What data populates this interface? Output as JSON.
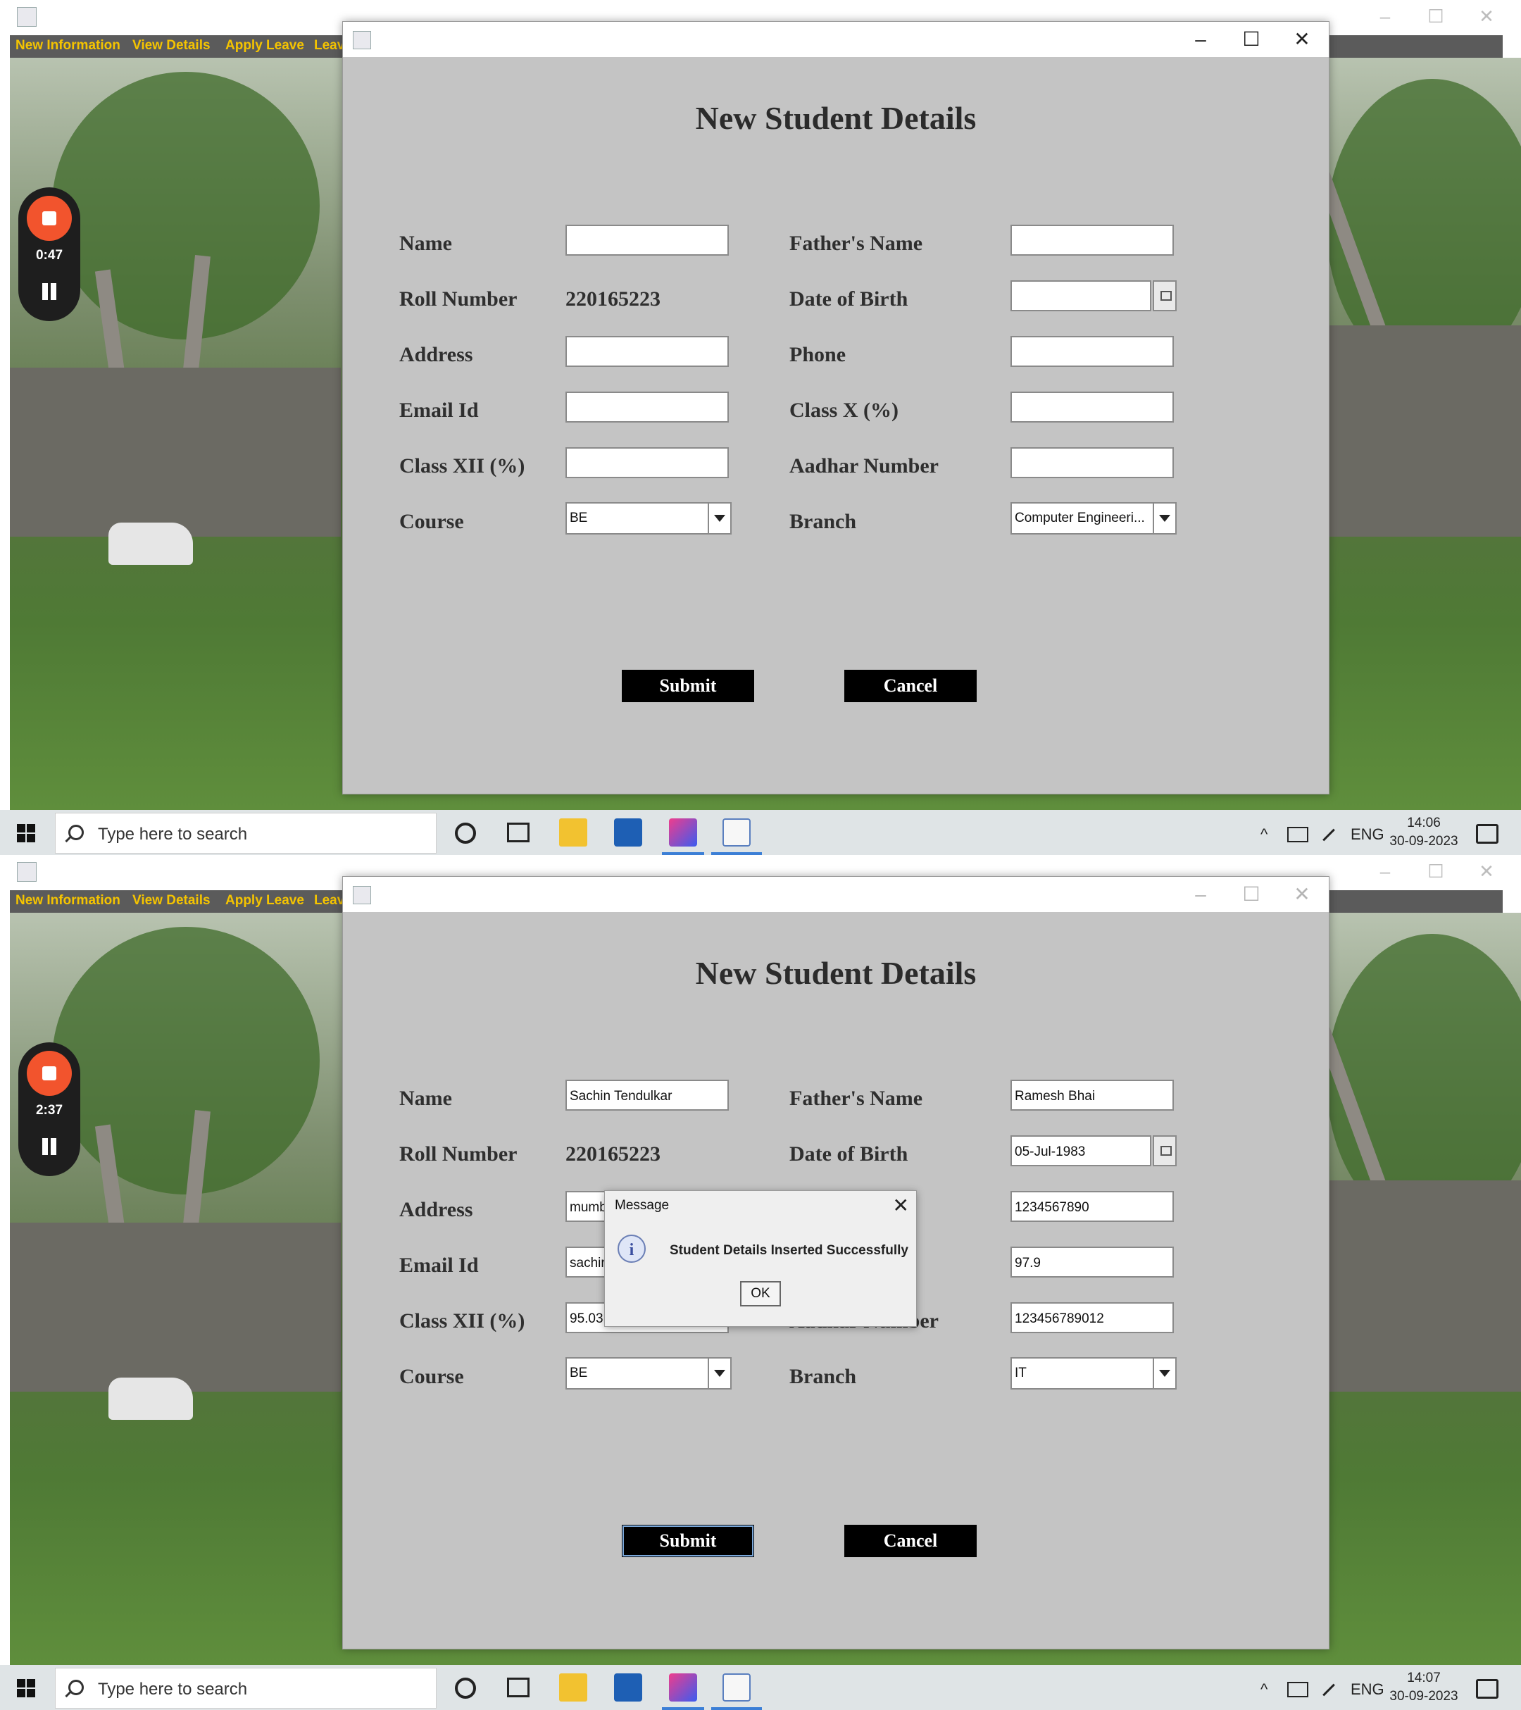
{
  "bg_window": {
    "menu": [
      "New Information",
      "View Details",
      "Apply Leave",
      "Leav"
    ],
    "controls": [
      "–",
      "☐",
      "✕"
    ]
  },
  "dialog": {
    "title": "New Student Details",
    "controls": [
      "–",
      "☐",
      "✕"
    ]
  },
  "labels": {
    "name": "Name",
    "fathers_name": "Father's Name",
    "roll_number": "Roll Number",
    "dob": "Date of Birth",
    "address": "Address",
    "phone": "Phone",
    "email": "Email Id",
    "class_x": "Class X (%)",
    "class_xii": "Class XII (%)",
    "aadhar": "Aadhar Number",
    "course": "Course",
    "branch": "Branch"
  },
  "buttons": {
    "submit": "Submit",
    "cancel": "Cancel"
  },
  "screens": [
    {
      "recorder_time": "0:47",
      "roll_number": "220165223",
      "fields": {
        "name": "",
        "fathers_name": "",
        "dob": "",
        "address": "",
        "phone": "",
        "email": "",
        "class_x": "",
        "class_xii": "",
        "aadhar": ""
      },
      "course": "BE",
      "branch": "Computer Engineeri...",
      "clock": {
        "time": "14:06",
        "date": "30-09-2023"
      }
    },
    {
      "recorder_time": "2:37",
      "roll_number": "220165223",
      "fields": {
        "name": "Sachin Tendulkar",
        "fathers_name": "Ramesh Bhai",
        "dob": "05-Jul-1983",
        "address": "mumb",
        "phone": "1234567890",
        "email": "sachir",
        "class_x": "97.9",
        "class_xii": "95.03",
        "aadhar": "123456789012"
      },
      "course": "BE",
      "branch": "IT",
      "message_dialog": {
        "title": "Message",
        "text": "Student Details Inserted Successfully",
        "ok": "OK",
        "close": "✕",
        "icon": "i"
      },
      "clock": {
        "time": "14:07",
        "date": "30-09-2023"
      }
    }
  ],
  "taskbar": {
    "search_placeholder": "Type here to search",
    "language": "ENG",
    "tray_up": "^",
    "icons": [
      "windows-start-icon",
      "search-icon",
      "cortana-icon",
      "task-view-icon",
      "file-explorer-icon",
      "store-icon",
      "intellij-icon",
      "java-app-icon",
      "battery-icon",
      "pen-icon",
      "notification-icon"
    ]
  }
}
